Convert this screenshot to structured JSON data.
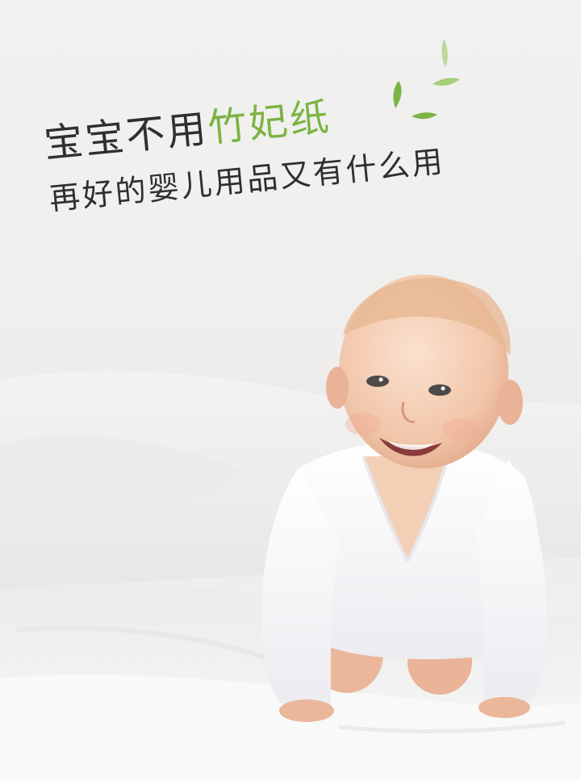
{
  "headline": {
    "line1_prefix": "宝宝不用",
    "line1_accent": "竹妃纸",
    "line2": "再好的婴儿用品又有什么用"
  },
  "colors": {
    "accent": "#7cb342",
    "text": "#2f2f2f",
    "background": "#f1f1f0"
  },
  "decorations": {
    "leaves_icon": "bamboo-leaves-icon"
  },
  "image": {
    "subject": "smiling baby in white onesie crawling on white bedding"
  }
}
